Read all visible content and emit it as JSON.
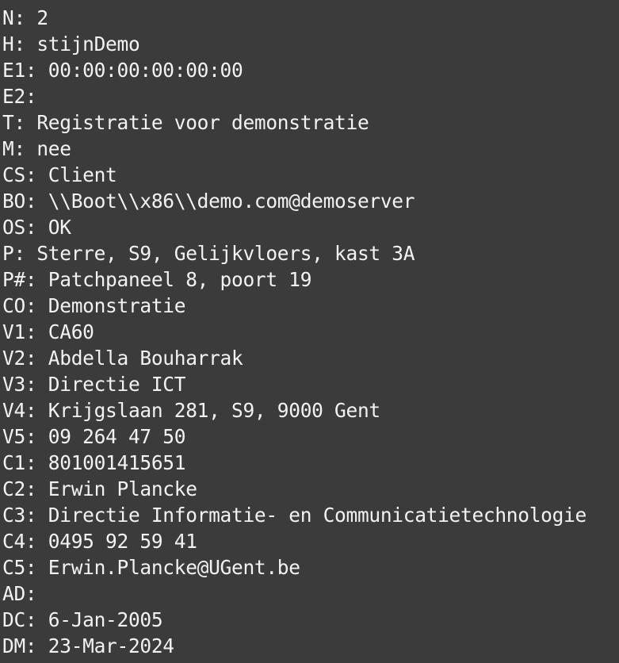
{
  "colors": {
    "background": "#3b3b3b",
    "text": "#f2f2f2"
  },
  "lines": [
    "N: 2",
    "H: stijnDemo",
    "E1: 00:00:00:00:00:00",
    "E2:",
    "T: Registratie voor demonstratie",
    "M: nee",
    "CS: Client",
    "BO: \\\\Boot\\\\x86\\\\demo.com@demoserver",
    "OS: OK",
    "P: Sterre, S9, Gelijkvloers, kast 3A",
    "P#: Patchpaneel 8, poort 19",
    "CO: Demonstratie",
    "V1: CA60",
    "V2: Abdella Bouharrak",
    "V3: Directie ICT",
    "V4: Krijgslaan 281, S9, 9000 Gent",
    "V5: 09 264 47 50",
    "C1: 801001415651",
    "C2: Erwin Plancke",
    "C3: Directie Informatie- en Communicatietechnologie",
    "C4: 0495 92 59 41",
    "C5: Erwin.Plancke@UGent.be",
    "AD:",
    "DC: 6-Jan-2005",
    "DM: 23-Mar-2024"
  ]
}
